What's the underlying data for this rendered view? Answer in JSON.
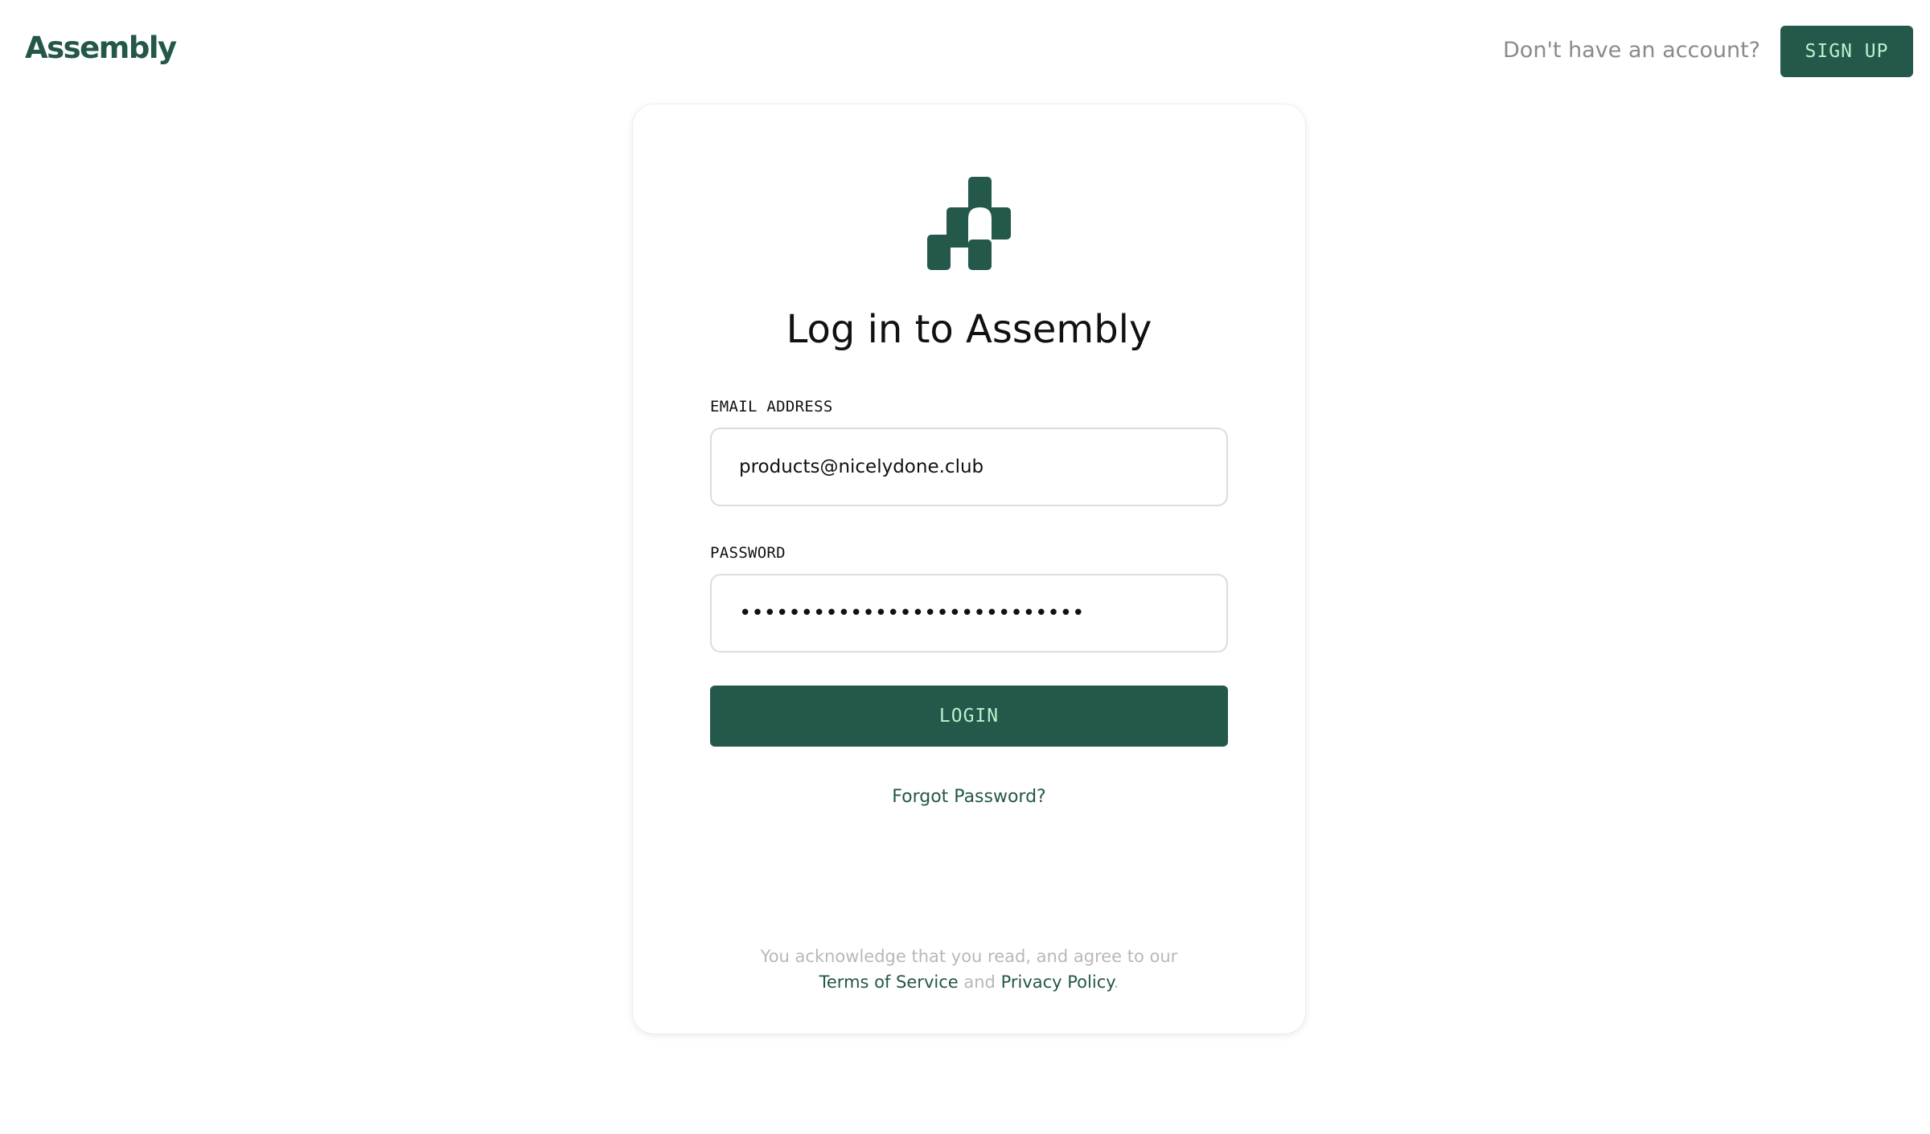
{
  "header": {
    "brand": "Assembly",
    "no_account_text": "Don't have an account?",
    "signup_label": "SIGN UP"
  },
  "login_card": {
    "logo_icon": "assembly-logo-icon",
    "title": "Log in to Assembly",
    "email": {
      "label": "EMAIL ADDRESS",
      "value": "products@nicelydone.club"
    },
    "password": {
      "label": "PASSWORD",
      "value": "••••••••••••••••••••••••••••"
    },
    "login_label": "LOGIN",
    "forgot_label": "Forgot Password?",
    "legal": {
      "line1": "You acknowledge that you read, and agree to our",
      "terms_label": "Terms of Service",
      "and_text": "and",
      "privacy_label": "Privacy Policy",
      "period": "."
    }
  },
  "colors": {
    "brand_green": "#23584b",
    "button_text": "#b9f1cc",
    "muted_text": "#8a8a8a",
    "legal_text": "#b8b8b8"
  }
}
